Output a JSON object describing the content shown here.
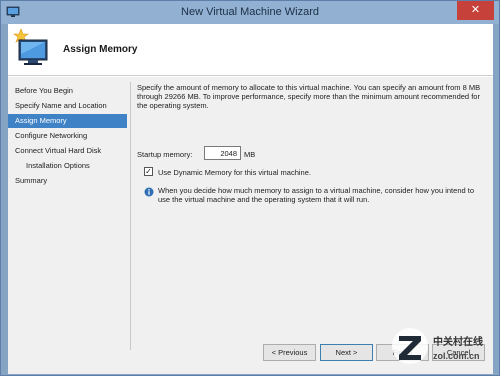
{
  "window": {
    "title": "New Virtual Machine Wizard",
    "close_glyph": "✕",
    "icon": "wizard-app-icon"
  },
  "header": {
    "title": "Assign Memory",
    "icon": "computer-star-icon"
  },
  "nav": {
    "items": [
      {
        "label": "Before You Begin",
        "active": false,
        "indent": false
      },
      {
        "label": "Specify Name and Location",
        "active": false,
        "indent": false
      },
      {
        "label": "Assign Memory",
        "active": true,
        "indent": false
      },
      {
        "label": "Configure Networking",
        "active": false,
        "indent": false
      },
      {
        "label": "Connect Virtual Hard Disk",
        "active": false,
        "indent": false
      },
      {
        "label": "Installation Options",
        "active": false,
        "indent": true
      },
      {
        "label": "Summary",
        "active": false,
        "indent": false
      }
    ]
  },
  "content": {
    "description": "Specify the amount of memory to allocate to this virtual machine. You can specify an amount from 8 MB through 29266 MB. To improve performance, specify more than the minimum amount recommended for the operating system.",
    "startup_memory_label": "Startup memory:",
    "startup_memory_value": "2048",
    "startup_memory_unit": "MB",
    "dynamic_memory_label": "Use Dynamic Memory for this virtual machine.",
    "dynamic_memory_checked": true,
    "check_glyph": "✓",
    "info_text": "When you decide how much memory to assign to a virtual machine, consider how you intend to use the virtual machine and the operating system that it will run."
  },
  "buttons": {
    "previous": "< Previous",
    "next": "Next >",
    "finish": "Finish",
    "cancel": "Cancel"
  },
  "watermark": {
    "chinese_text": "中关村在线",
    "site_text": "zol.com.cn"
  },
  "colors": {
    "titlebar": "#92b1d2",
    "frame": "#85a4c4",
    "close_button": "#c5413a",
    "selected_nav": "#3f82c6",
    "info_icon": "#2f6eb5"
  }
}
